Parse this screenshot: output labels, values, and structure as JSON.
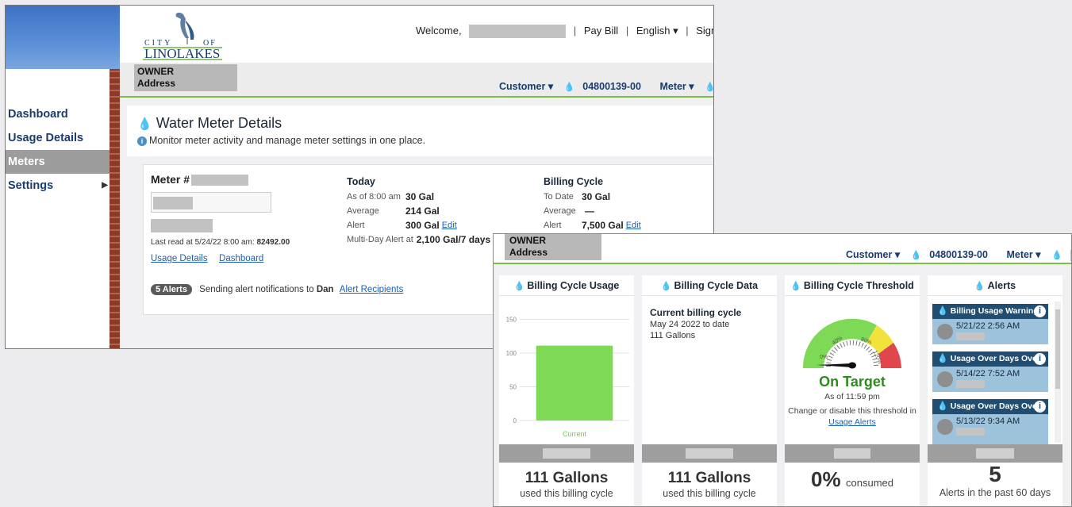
{
  "portal": {
    "welcome": "Welcome,",
    "pay_bill": "Pay Bill",
    "language": "English ▾",
    "sign": "Sign o",
    "logo_city": "CITY",
    "logo_of": "OF",
    "logo_name": "LINOLAKES"
  },
  "sidebar": {
    "items": [
      {
        "label": "Dashboard"
      },
      {
        "label": "Usage Details"
      },
      {
        "label": "Meters"
      },
      {
        "label": "Settings"
      }
    ]
  },
  "owner": {
    "name": "OWNER",
    "address": "Address"
  },
  "account": {
    "customer": "Customer ▾",
    "account_no": "04800139-00",
    "meter": "Meter ▾"
  },
  "meter_page": {
    "title": "Water Meter Details",
    "subtitle": "Monitor meter activity and manage meter settings in one place.",
    "meter_label": "Meter #",
    "last_read": "Last read at 5/24/22 8:00 am:",
    "last_read_value": "82492.00",
    "usage_details_link": "Usage Details",
    "dashboard_link": "Dashboard",
    "today": {
      "title": "Today",
      "as_of_label": "As of 8:00 am",
      "as_of_value": "30 Gal",
      "average_label": "Average",
      "average_value": "214 Gal",
      "alert_label": "Alert",
      "alert_value": "300 Gal",
      "edit": "Edit",
      "multiday_label": "Multi-Day Alert at",
      "multiday_value": "2,100 Gal/7 days"
    },
    "billing": {
      "title": "Billing Cycle",
      "todate_label": "To Date",
      "todate_value": "30 Gal",
      "average_label": "Average",
      "average_value": "—",
      "alert_label": "Alert",
      "alert_value": "7,500 Gal",
      "edit": "Edit"
    },
    "alerts_count": "5 Alerts",
    "alerts_text": "Sending alert notifications to",
    "alerts_to": "Dan",
    "alert_recipients": "Alert Recipients"
  },
  "dashboard": {
    "usage_card": {
      "title": "Billing Cycle Usage",
      "foot_value": "111 Gallons",
      "foot_sub": "used this billing cycle",
      "bar_label": "Current"
    },
    "data_card": {
      "title": "Billing Cycle Data",
      "heading": "Current billing cycle",
      "range": "May 24 2022 to date",
      "gallons": "111 Gallons",
      "foot_value": "111 Gallons",
      "foot_sub": "used this billing cycle"
    },
    "threshold_card": {
      "title": "Billing Cycle Threshold",
      "status": "On Target",
      "as_of": "As of 11:59 pm",
      "change_text": "Change or disable this threshold in",
      "usage_alerts_link": "Usage Alerts",
      "foot_value": "0%",
      "foot_sub": "consumed",
      "gauge_labels": [
        "0%",
        "40%",
        "80%",
        "120%"
      ],
      "gauge_value_pct": 0
    },
    "alerts_card": {
      "title": "Alerts",
      "items": [
        {
          "title": "Billing Usage Warning",
          "date": "5/21/22 2:56 AM"
        },
        {
          "title": "Usage Over Days Ove...",
          "date": "5/14/22 7:52 AM"
        },
        {
          "title": "Usage Over Days Ove...",
          "date": "5/13/22 9:34 AM"
        }
      ],
      "foot_value": "5",
      "foot_sub": "Alerts in the past 60 days"
    }
  },
  "chart_data": {
    "type": "bar",
    "categories": [
      "Current"
    ],
    "values": [
      111
    ],
    "title": "Billing Cycle Usage",
    "ylim": [
      0,
      160
    ],
    "yticks": [
      0,
      50,
      100,
      150
    ],
    "grid": true,
    "bar_color": "#7ed957"
  }
}
